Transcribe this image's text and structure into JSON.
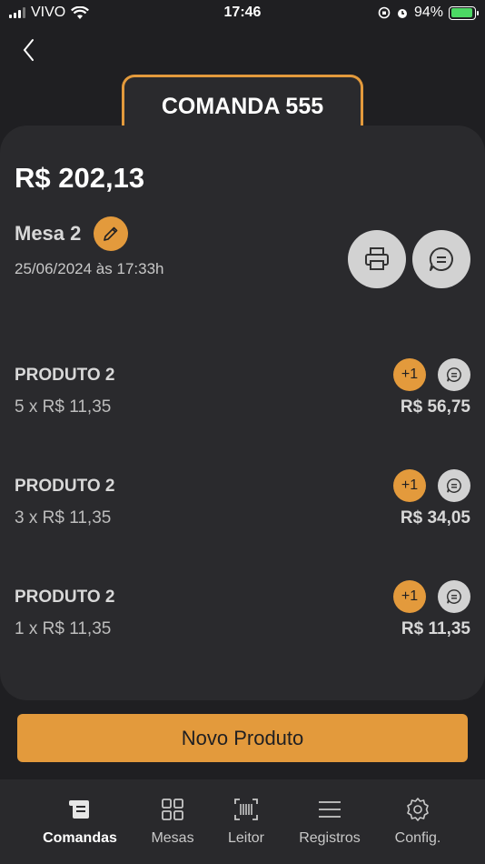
{
  "status_bar": {
    "carrier": "VIVO",
    "time": "17:46",
    "battery": "94%"
  },
  "header": {
    "title": "COMANDA 555"
  },
  "order": {
    "total": "R$ 202,13",
    "mesa": "Mesa 2",
    "datetime": "25/06/2024 às 17:33h"
  },
  "products": [
    {
      "name": "PRODUTO 2",
      "qty": "5 x R$ 11,35",
      "total": "R$ 56,75",
      "plus_label": "+1"
    },
    {
      "name": "PRODUTO 2",
      "qty": "3 x R$ 11,35",
      "total": "R$ 34,05",
      "plus_label": "+1"
    },
    {
      "name": "PRODUTO 2",
      "qty": "1 x R$ 11,35",
      "total": "R$ 11,35",
      "plus_label": "+1"
    }
  ],
  "actions": {
    "new_product": "Novo Produto"
  },
  "tabs": [
    {
      "label": "Comandas",
      "icon": "receipt-icon",
      "active": true
    },
    {
      "label": "Mesas",
      "icon": "grid-icon",
      "active": false
    },
    {
      "label": "Leitor",
      "icon": "barcode-icon",
      "active": false
    },
    {
      "label": "Registros",
      "icon": "list-icon",
      "active": false
    },
    {
      "label": "Config.",
      "icon": "gear-icon",
      "active": false
    }
  ],
  "colors": {
    "accent": "#e39a3c",
    "background": "#1f1f22",
    "card": "#2a2a2d",
    "light_button": "#d2d2d2"
  }
}
